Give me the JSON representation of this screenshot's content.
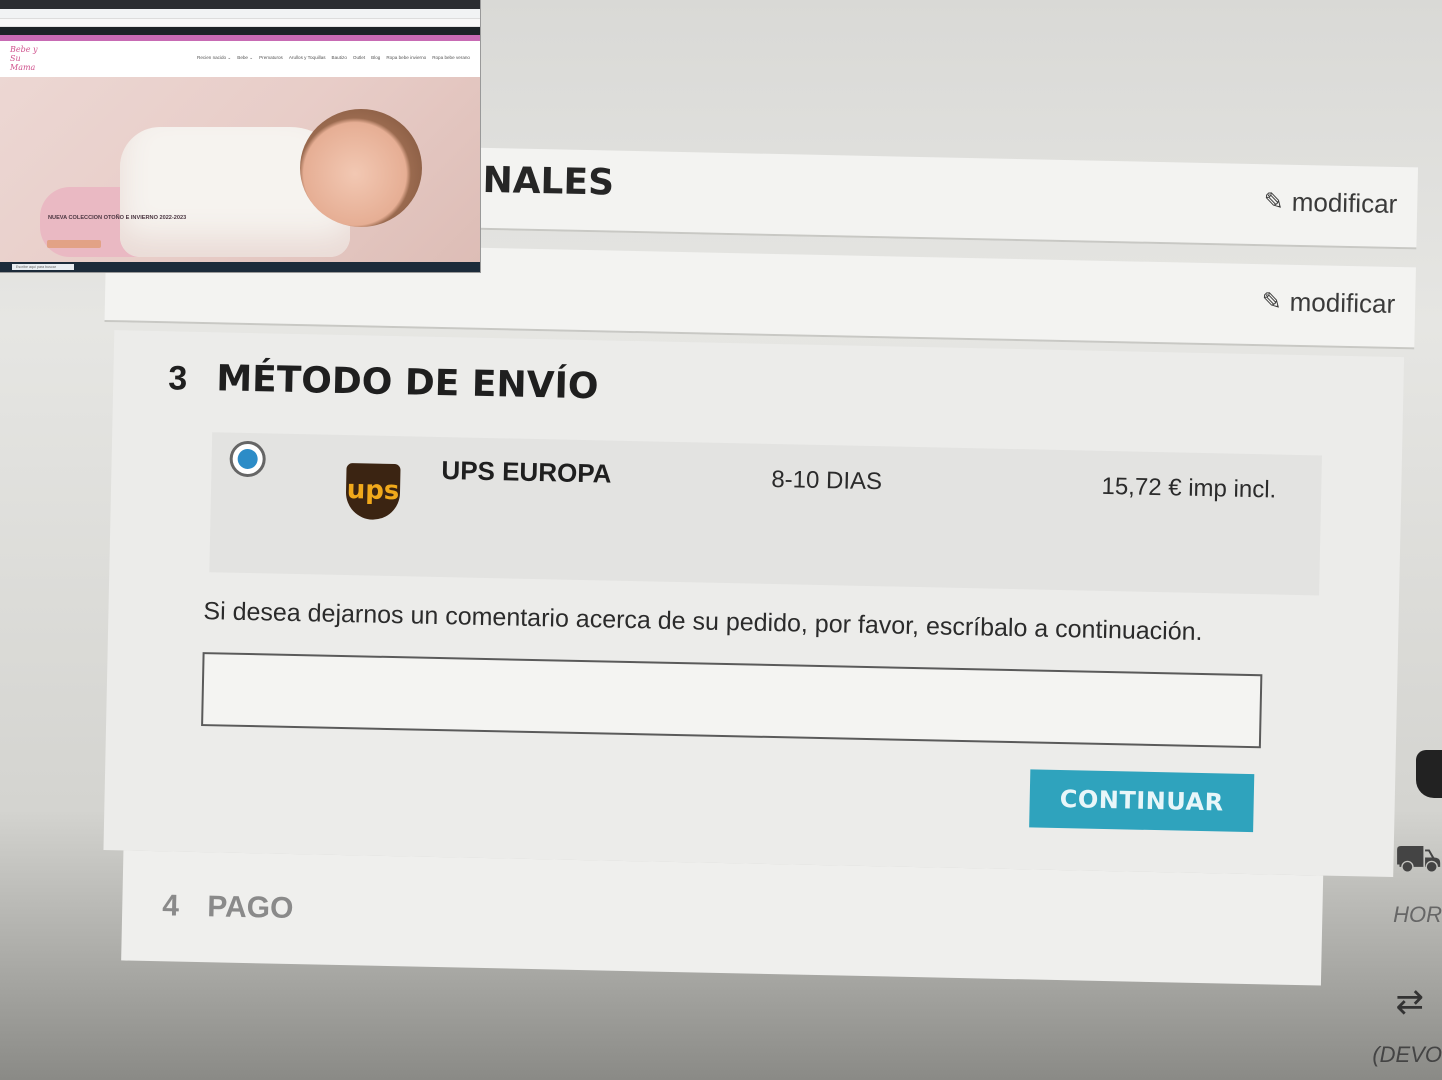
{
  "checkout": {
    "step1": {
      "title": "NALES",
      "modify_label": "modificar"
    },
    "step2": {
      "modify_label": "modificar"
    },
    "step3": {
      "number": "3",
      "title": "MÉTODO DE ENVÍO",
      "carrier": {
        "logo_text": "ups",
        "name": "UPS EUROPA",
        "delay": "8-10 DIAS",
        "price": "15,72 € imp incl.",
        "selected": true
      },
      "comment_label": "Si desea dejarnos un comentario acerca de su pedido, por favor, escríbalo a continuación.",
      "comment_value": "",
      "continue_label": "CONTINUAR"
    },
    "step4": {
      "number": "4",
      "title": "PAGO"
    }
  },
  "side_reassurance": {
    "items": [
      "shield-icon",
      "truck-icon",
      "swap-icon"
    ],
    "hours_label": "HOR",
    "returns_label": "(DEVO"
  },
  "inset_screenshot": {
    "logo": "Bebe y Su Mama",
    "nav": [
      "Recien nacido ⌄",
      "Bebe ⌄",
      "Prematuros",
      "Arullos y Toquillas",
      "Bautizo",
      "Outlet",
      "Blog",
      "Ropa bebe invierno",
      "Ropa bebe verano"
    ],
    "hero_caption": "NUEVA COLECCION OTOÑO E INVIERNO 2022-2023",
    "taskbar_search": "Escribe aquí para buscar"
  },
  "colors": {
    "continue_button": "#2fa3bd",
    "radio_selected": "#2c8cc7",
    "ups_brown": "#3b2412",
    "ups_gold": "#f1a91b"
  }
}
